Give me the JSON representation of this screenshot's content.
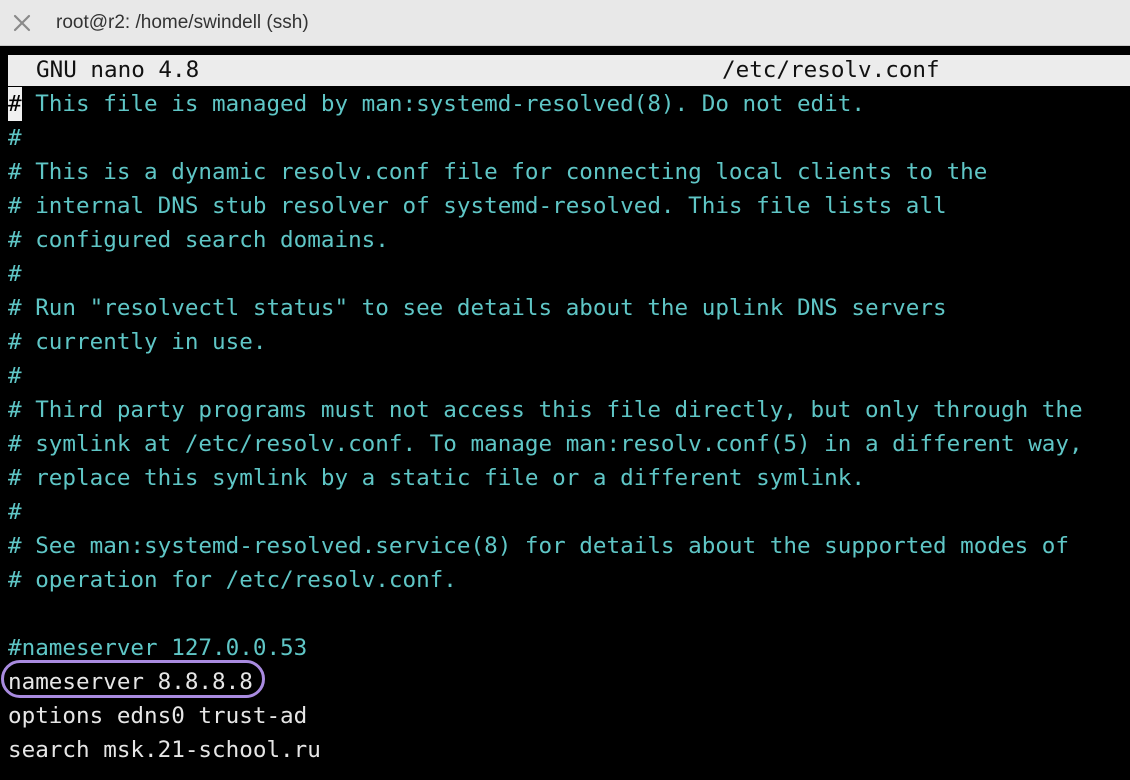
{
  "window": {
    "title": "root@r2: /home/swindell (ssh)"
  },
  "nano": {
    "version_label": "GNU nano 4.8",
    "filename": "/etc/resolv.conf"
  },
  "file_lines": [
    {
      "text": "# This file is managed by man:systemd-resolved(8). Do not edit.",
      "kind": "comment"
    },
    {
      "text": "#",
      "kind": "comment"
    },
    {
      "text": "# This is a dynamic resolv.conf file for connecting local clients to the",
      "kind": "comment"
    },
    {
      "text": "# internal DNS stub resolver of systemd-resolved. This file lists all",
      "kind": "comment"
    },
    {
      "text": "# configured search domains.",
      "kind": "comment"
    },
    {
      "text": "#",
      "kind": "comment"
    },
    {
      "text": "# Run \"resolvectl status\" to see details about the uplink DNS servers",
      "kind": "comment"
    },
    {
      "text": "# currently in use.",
      "kind": "comment"
    },
    {
      "text": "#",
      "kind": "comment"
    },
    {
      "text": "# Third party programs must not access this file directly, but only through the",
      "kind": "comment"
    },
    {
      "text": "# symlink at /etc/resolv.conf. To manage man:resolv.conf(5) in a different way,",
      "kind": "comment"
    },
    {
      "text": "# replace this symlink by a static file or a different symlink.",
      "kind": "comment"
    },
    {
      "text": "#",
      "kind": "comment"
    },
    {
      "text": "# See man:systemd-resolved.service(8) for details about the supported modes of",
      "kind": "comment"
    },
    {
      "text": "# operation for /etc/resolv.conf.",
      "kind": "comment"
    },
    {
      "text": "",
      "kind": "blank"
    },
    {
      "text": "#nameserver 127.0.0.53",
      "kind": "comment"
    },
    {
      "text": "nameserver 8.8.8.8",
      "kind": "plain"
    },
    {
      "text": "options edns0 trust-ad",
      "kind": "plain"
    },
    {
      "text": "search msk.21-school.ru",
      "kind": "plain"
    }
  ],
  "first_line": {
    "cursor_char": "#",
    "rest": " This file is managed by man:systemd-resolved(8). Do not edit."
  },
  "highlight": {
    "line_index": 17,
    "color": "#a98be0"
  },
  "colors": {
    "comment": "#5fc6c6",
    "plain": "#e6e6e6",
    "background": "#000000"
  },
  "icons": {
    "close": "close-icon"
  }
}
